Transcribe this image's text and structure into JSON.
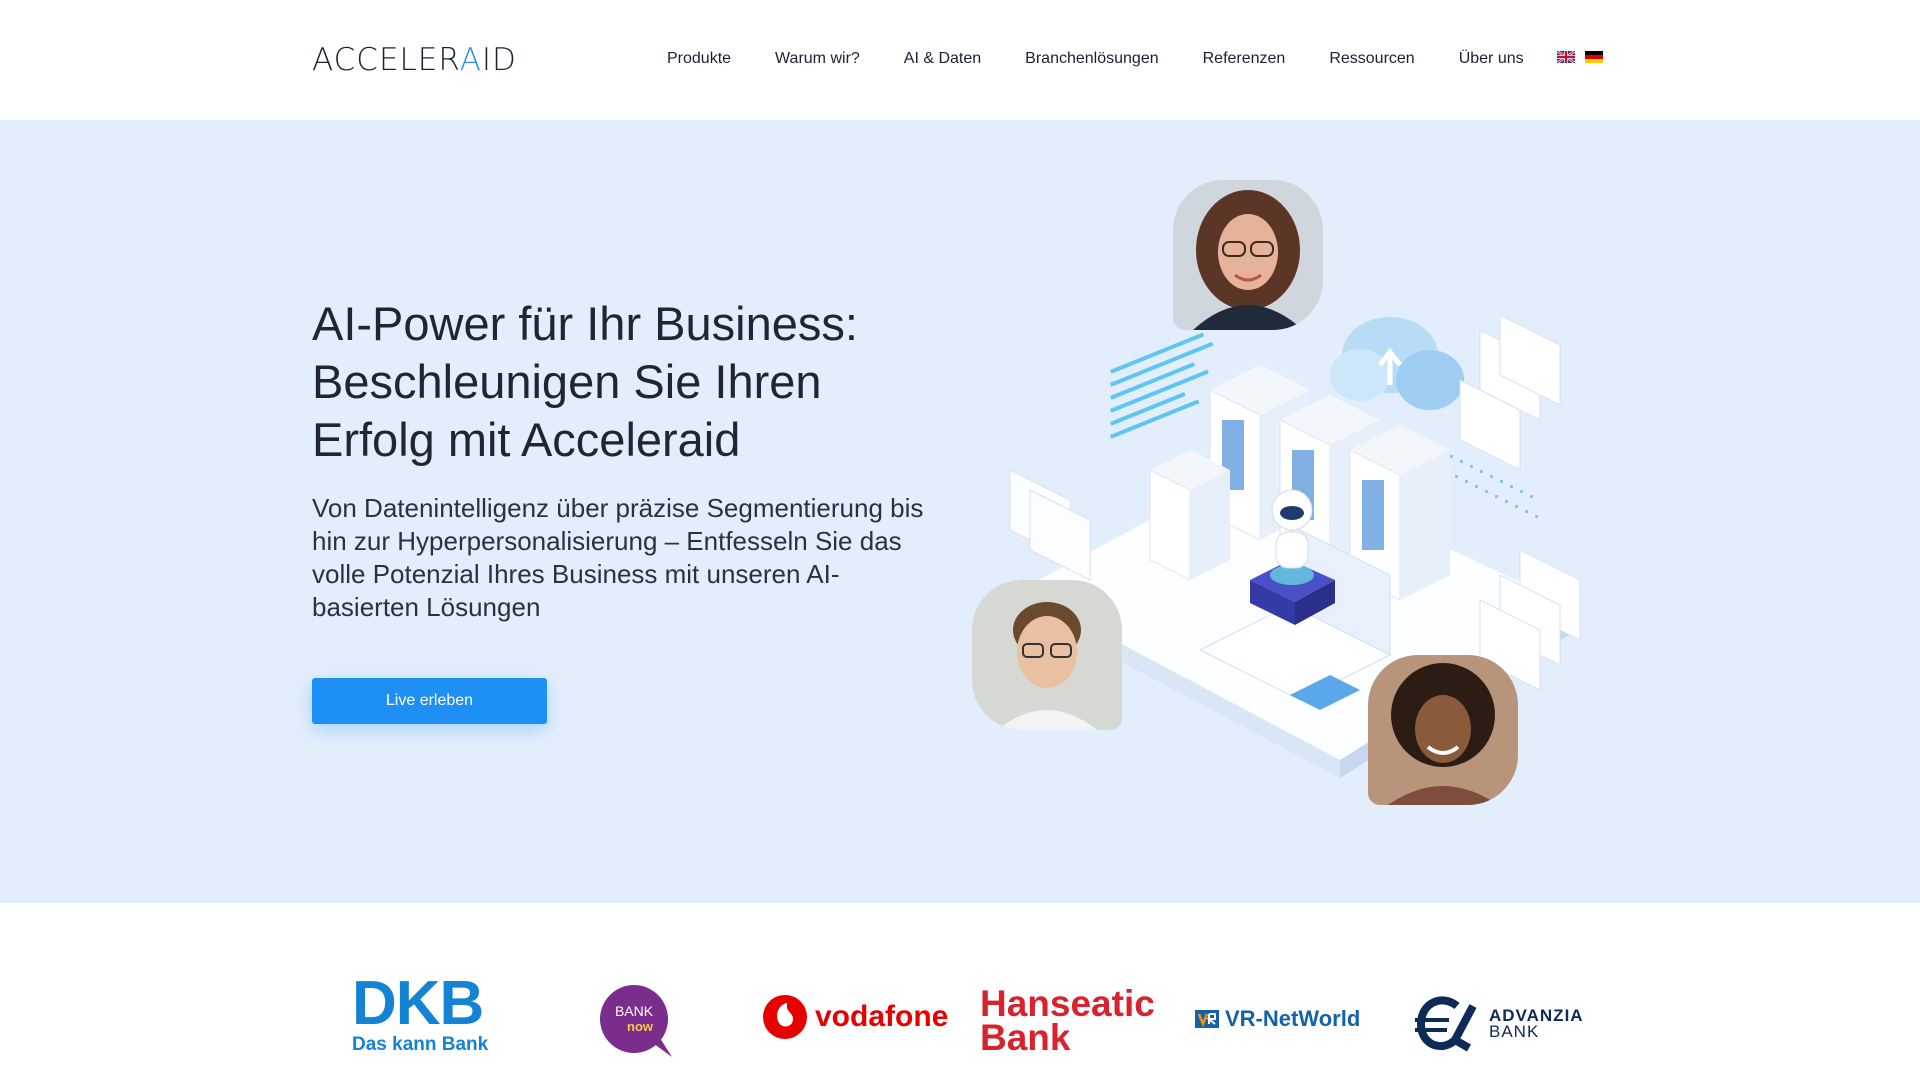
{
  "header": {
    "logo": {
      "prefix": "ACCELER",
      "accent": "A",
      "suffix": "ID"
    },
    "nav": [
      "Produkte",
      "Warum wir?",
      "AI & Daten",
      "Branchenlösungen",
      "Referenzen",
      "Ressourcen",
      "Über uns"
    ],
    "flags": [
      "flag-uk-icon",
      "flag-de-icon"
    ]
  },
  "hero": {
    "headline": "AI-Power für Ihr Business: Beschleunigen Sie Ihren Erfolg mit Acceleraid",
    "lead": "Von Datenintelligenz über präzise Segmentierung bis hin zur Hyperpersonalisierung – Entfesseln Sie das volle Potenzial Ihres Business mit unseren AI-basierten Lösungen",
    "cta_label": "Live erleben"
  },
  "logos": {
    "dkb": {
      "big": "DKB",
      "small": "Das kann Bank"
    },
    "banknow": {
      "line1": "BANK",
      "line2": "now"
    },
    "vodafone": "vodafone",
    "hanseatic": {
      "line1": "Hanseatic",
      "line2": "Bank"
    },
    "vrnetworld": "VR-NetWorld",
    "advanzia": {
      "line1": "ADVANZIA",
      "line2": "BANK"
    }
  },
  "colors": {
    "accent": "#1e8ff5",
    "hero_bg": "#e2eefc",
    "dkb": "#1483d4",
    "vodafone": "#e60000",
    "hanseatic": "#d8232e",
    "banknow": "#7b2d8e",
    "advanzia": "#0f2a56"
  }
}
